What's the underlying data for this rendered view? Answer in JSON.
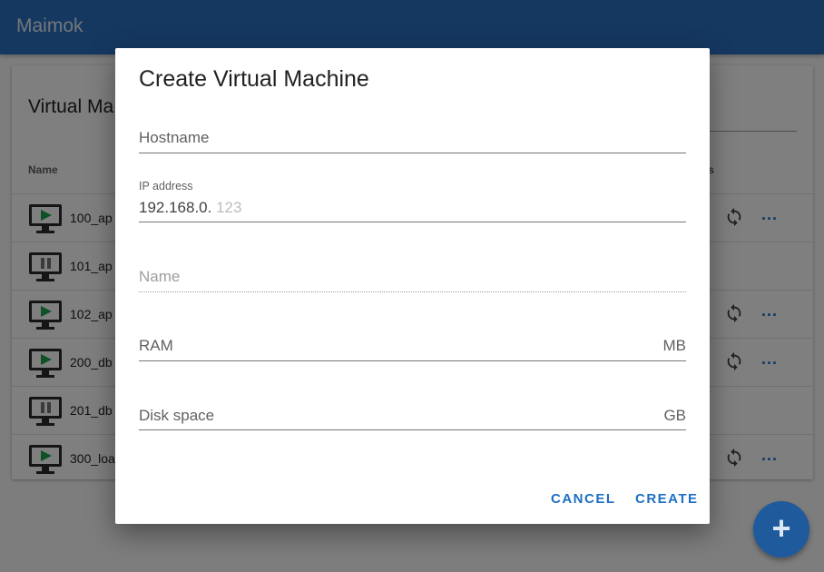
{
  "app": {
    "title": "Maimok"
  },
  "card": {
    "title": "Virtual Ma",
    "columns": {
      "name": "Name",
      "actions": "ns"
    },
    "rows": [
      {
        "name": "100_ap",
        "status": "running"
      },
      {
        "name": "101_ap",
        "status": "paused"
      },
      {
        "name": "102_ap",
        "status": "running"
      },
      {
        "name": "200_db",
        "status": "running"
      },
      {
        "name": "201_db",
        "status": "paused"
      },
      {
        "name": "300_loa",
        "status": "running"
      }
    ],
    "more_label": "..."
  },
  "dialog": {
    "title": "Create Virtual Machine",
    "hostname": {
      "label": "Hostname",
      "value": ""
    },
    "ip": {
      "label": "IP address",
      "prefix": "192.168.0.",
      "placeholder": "123"
    },
    "name": {
      "label": "Name"
    },
    "ram": {
      "label": "RAM",
      "suffix": "MB"
    },
    "disk": {
      "label": "Disk space",
      "suffix": "GB"
    },
    "cancel_label": "CANCEL",
    "create_label": "CREATE"
  },
  "fab": {
    "label": "+"
  },
  "colors": {
    "primary": "#2a70c2",
    "accent": "#1e6fc2",
    "fab": "#1f5a9d"
  }
}
